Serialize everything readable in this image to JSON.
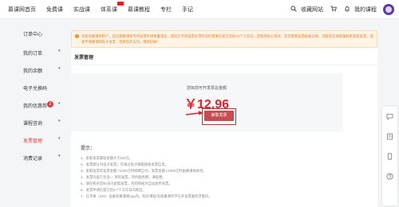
{
  "nav": {
    "items": [
      "慕课网首页",
      "免费课",
      "实战课",
      "体系课",
      "慕课教程",
      "专栏",
      "手记"
    ],
    "search_icon": "search-icon",
    "cart_icon": "cart-icon",
    "bell_icon": "bell-icon",
    "collect": "收藏网站",
    "my_course": "我的课程"
  },
  "sidebar": {
    "title": "订单中心",
    "items": [
      {
        "label": "我的订单",
        "chevron": "▾"
      },
      {
        "label": "我的余额",
        "chevron": "▾"
      },
      {
        "label": "电子兑换码",
        "chevron": ""
      },
      {
        "label": "我的优惠券",
        "chevron": "▾",
        "count": "3"
      },
      {
        "label": "课程咨询",
        "chevron": "▾"
      },
      {
        "label": "发票管理",
        "chevron": "▾"
      },
      {
        "label": "消费记录",
        "chevron": "▾"
      }
    ],
    "active_index": 5
  },
  "notice": {
    "text": "亲爱的慕课网用户，因近期慕课网专用发票申请数量增多，请您在专用发票开票时间约需要在提交后的20个工作日，还请您耐心等待，若您需要发票报备证明，可联系在线客服联系获取发票，或者申请慕课网电子发票，感谢您的支持，敬请谅解！"
  },
  "card": {
    "title": "发票管理"
  },
  "invoice": {
    "caption": "您目前可开发票总金额",
    "amount": "￥12.96",
    "button": "索取发票"
  },
  "tips": {
    "title": "提示：",
    "items": [
      "1、索取发票最低金额大于100元。",
      "2、发票默认为电子发票，可通过电子邮箱接收发票信息。",
      "3、索取发票的发票金额 <1000元时邮费自付，发票金额 ≥1000元时由慕课网承担。",
      "4、发票内容只包含一 项目发票、项目服务费、课程费。",
      "5、请在购买后90天内索取发票，否则将视为自动放弃发票。",
      "6、发票申请在提交后3-7个工作日内寄出。",
      "7、在苹果（iOS）设备的慕课网App内，购买课程/充值慕课币不在开发票服务范围内。"
    ]
  },
  "float_toolbar": {
    "icons": [
      "chat-icon",
      "feedback-icon",
      "phone-icon",
      "help-icon"
    ]
  },
  "colors": {
    "accent": "#e0262b",
    "notice_bg": "#fff3e6",
    "notice_text": "#e0862e",
    "button": "#c74b50"
  }
}
